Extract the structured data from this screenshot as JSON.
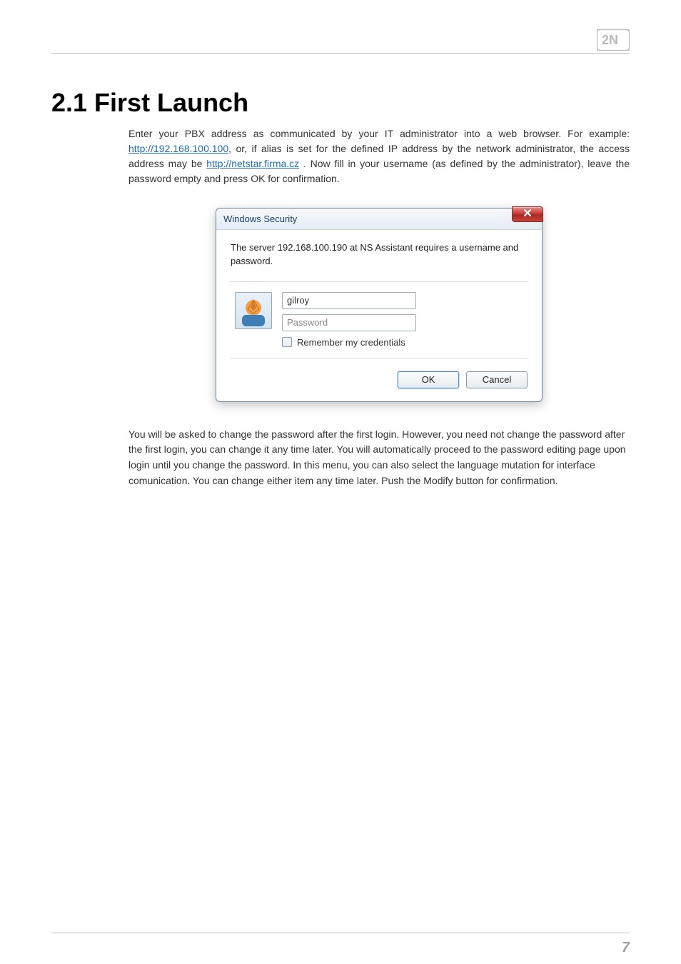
{
  "logo_name": "2N",
  "heading": "2.1 First Launch",
  "para1": {
    "t1": "Enter your PBX address as communicated by your IT administrator into a web browser. For example: ",
    "link1": "http://192.168.100.100",
    "t2": ", or, if alias is set for the defined IP address by the network administrator, the access address may be ",
    "link2": "http://netstar.firma.cz",
    "t3": " . Now fill in your username (as defined by the administrator), leave the password empty and press OK for confirmation."
  },
  "dialog": {
    "title": "Windows Security",
    "prompt": "The server 192.168.100.190 at NS Assistant requires a username and password.",
    "username_value": "gilroy",
    "password_placeholder": "Password",
    "remember_label": "Remember my credentials",
    "ok_label": "OK",
    "cancel_label": "Cancel"
  },
  "para2": "You will be asked to change the password after the first login. However, you need not change the password after the first login, you can change it any time later. You will automatically proceed to the password editing page upon login until you change the password. In this menu, you can also select the language mutation for interface comunication. You can change either item any time later. Push the Modify button for confirmation.",
  "page_number": "7"
}
